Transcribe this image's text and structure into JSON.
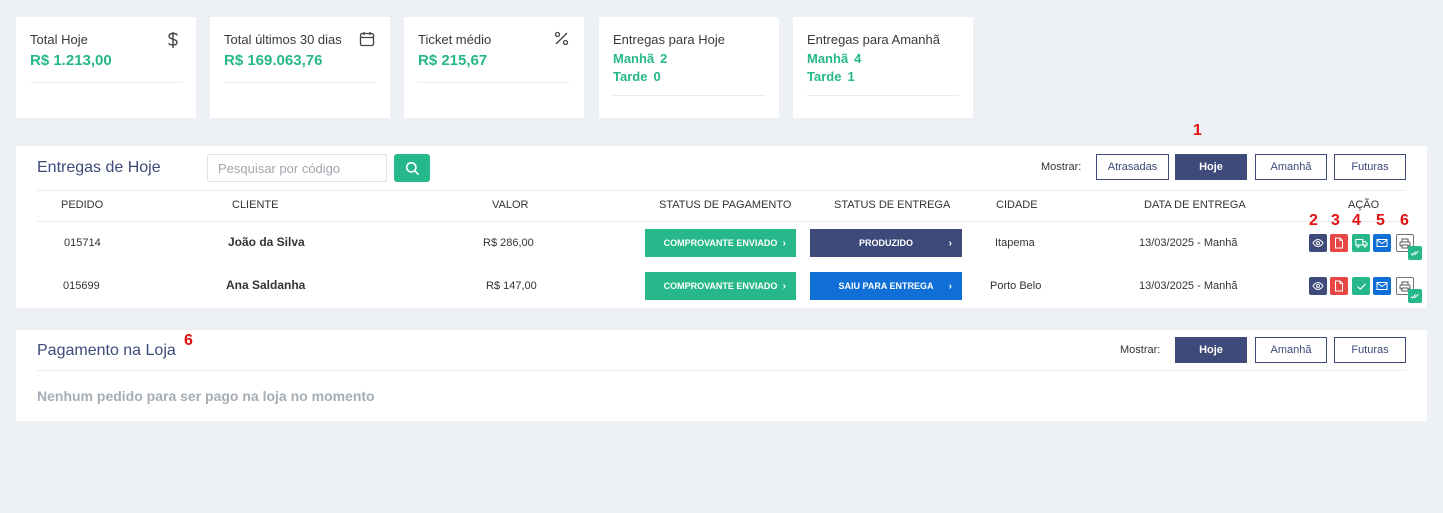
{
  "cards": [
    {
      "title": "Total Hoje",
      "value": "R$ 1.213,00",
      "icon": "dollar-icon"
    },
    {
      "title": "Total últimos 30 dias",
      "value": "R$ 169.063,76",
      "icon": "calendar-icon"
    },
    {
      "title": "Ticket médio",
      "value": "R$ 215,67",
      "icon": "percent-icon"
    },
    {
      "title": "Entregas para Hoje",
      "morning_label": "Manhã",
      "morning_count": "2",
      "afternoon_label": "Tarde",
      "afternoon_count": "0"
    },
    {
      "title": "Entregas para Amanhã",
      "morning_label": "Manhã",
      "morning_count": "4",
      "afternoon_label": "Tarde",
      "afternoon_count": "1"
    }
  ],
  "deliveries": {
    "title": "Entregas de Hoje",
    "search_placeholder": "Pesquisar por código",
    "show_label": "Mostrar:",
    "filters": [
      "Atrasadas",
      "Hoje",
      "Amanhã",
      "Futuras"
    ],
    "active_filter": "Hoje",
    "columns": [
      "PEDIDO",
      "CLIENTE",
      "VALOR",
      "STATUS DE PAGAMENTO",
      "STATUS DE ENTREGA",
      "CIDADE",
      "DATA DE ENTREGA",
      "AÇÃO"
    ],
    "rows": [
      {
        "order": "015714",
        "client": "João da Silva",
        "value": "R$ 286,00",
        "payment_status": "COMPROVANTE ENVIADO",
        "delivery_status": "PRODUZIDO",
        "city": "Itapema",
        "date": "13/03/2025 - Manhã"
      },
      {
        "order": "015699",
        "client": "Ana Saldanha",
        "value": "R$ 147,00",
        "payment_status": "COMPROVANTE ENVIADO",
        "delivery_status": "SAIU PARA ENTREGA",
        "city": "Porto Belo",
        "date": "13/03/2025 - Manhã"
      }
    ]
  },
  "store_payment": {
    "title": "Pagamento na Loja",
    "show_label": "Mostrar:",
    "filters": [
      "Hoje",
      "Amanhã",
      "Futuras"
    ],
    "active_filter": "Hoje",
    "empty_message": "Nenhum pedido para ser pago na loja no momento"
  },
  "annotations": {
    "a1": "1",
    "a2": "2",
    "a3": "3",
    "a4": "4",
    "a5": "5",
    "a6": "6",
    "a7": "6"
  },
  "colors": {
    "accent": "#26b88a",
    "primary": "#3d4a7a",
    "blue": "#0f6fd6",
    "red": "#e84545",
    "annotation": "#e01010"
  }
}
